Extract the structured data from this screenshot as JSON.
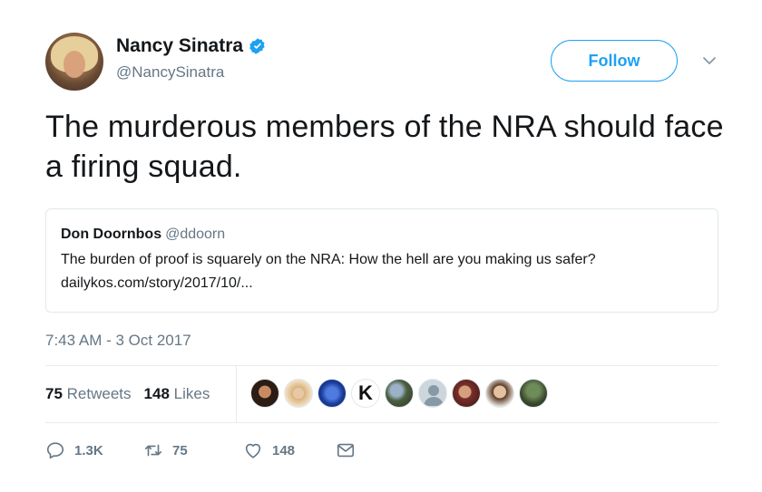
{
  "author": {
    "display_name": "Nancy Sinatra",
    "handle": "@NancySinatra",
    "verified": true
  },
  "follow_label": "Follow",
  "tweet_text": "The murderous members of the NRA should face a firing squad.",
  "quoted_tweet": {
    "display_name": "Don Doornbos",
    "handle": "@ddoorn",
    "text": "The burden of proof is squarely on the NRA: How the hell are you making us safer?",
    "link": "dailykos.com/story/2017/10/..."
  },
  "timestamp": "7:43 AM - 3 Oct 2017",
  "stats": {
    "retweets_count": "75",
    "retweets_label": "Retweets",
    "likes_count": "148",
    "likes_label": "Likes"
  },
  "liker_avatar_letter": "K",
  "actions": {
    "replies": "1.3K",
    "retweets": "75",
    "likes": "148"
  },
  "colors": {
    "accent": "#1da1f2",
    "secondary_text": "#657786",
    "primary_text": "#14171a"
  }
}
